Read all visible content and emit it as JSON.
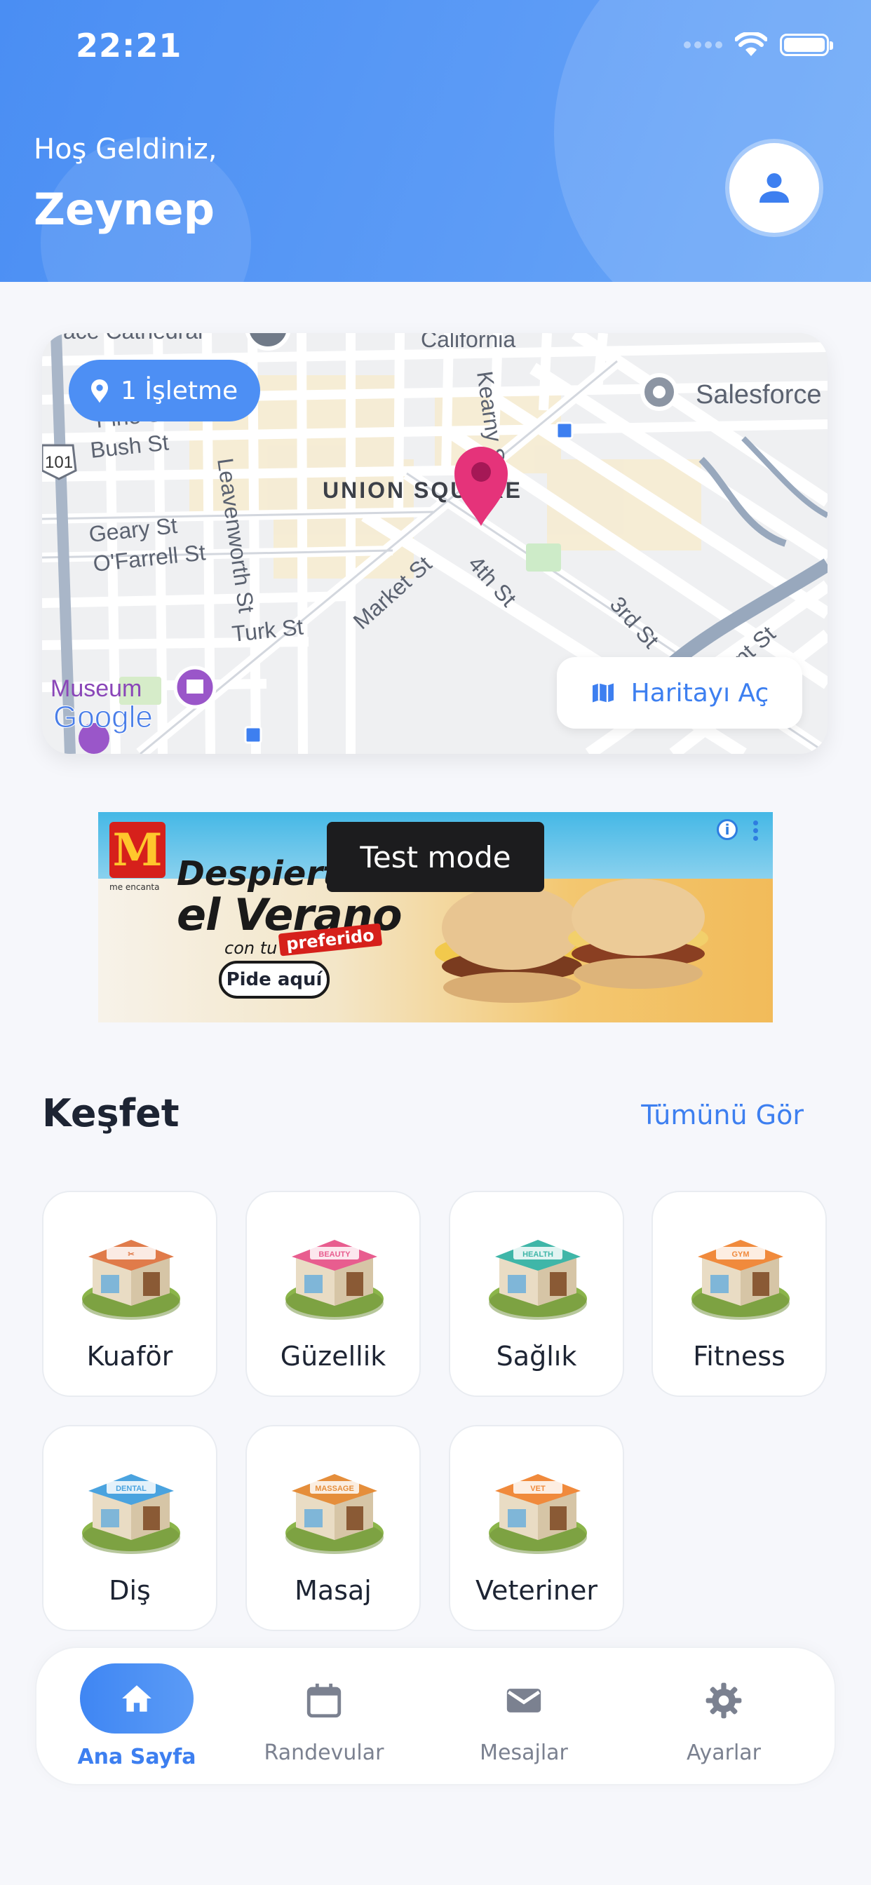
{
  "status_bar": {
    "time": "22:21"
  },
  "header": {
    "greeting": "Hoş Geldiniz,",
    "name": "Zeynep",
    "avatar_icon": "person-icon"
  },
  "map": {
    "badge_text": "1 İşletme",
    "open_button": "Haritayı Aç",
    "labels": {
      "union_square": "UNION SQUARE",
      "salesforce": "Salesforce",
      "kearny": "Kearny St",
      "bush": "Bush St",
      "pine": "Pine St",
      "geary": "Geary St",
      "ofarrell": "O'Farrell St",
      "turk": "Turk St",
      "leavenworth": "Leavenworth St",
      "market": "Market St",
      "fourth": "4th St",
      "third": "3rd St",
      "bryant": "Bryant St",
      "museum": "Museum",
      "google": "Google",
      "route": "101",
      "california": "California",
      "cathedral": "ace Cathedral"
    }
  },
  "ad": {
    "test_mode": "Test mode",
    "brand_sub": "me encanta",
    "line1": "Despierta",
    "line2": "el Verano",
    "line3": "con tu",
    "tag": "preferido",
    "cta": "Pide aquí"
  },
  "explore": {
    "title": "Keşfet",
    "see_all": "Tümünü Gör",
    "categories": [
      {
        "label": "Kuaför",
        "sign": "✂"
      },
      {
        "label": "Güzellik",
        "sign": "BEAUTY"
      },
      {
        "label": "Sağlık",
        "sign": "HEALTH"
      },
      {
        "label": "Fitness",
        "sign": "GYM"
      },
      {
        "label": "Diş",
        "sign": "DENTAL"
      },
      {
        "label": "Masaj",
        "sign": "MASSAGE"
      },
      {
        "label": "Veteriner",
        "sign": "VET"
      }
    ]
  },
  "nav": {
    "items": [
      {
        "label": "Ana Sayfa",
        "icon": "home-icon",
        "active": true
      },
      {
        "label": "Randevular",
        "icon": "calendar-icon"
      },
      {
        "label": "Mesajlar",
        "icon": "mail-icon"
      },
      {
        "label": "Ayarlar",
        "icon": "gear-icon"
      }
    ]
  },
  "colors": {
    "primary": "#4a8ef3",
    "active": "#3d7ff0",
    "marker": "#e5337a"
  }
}
